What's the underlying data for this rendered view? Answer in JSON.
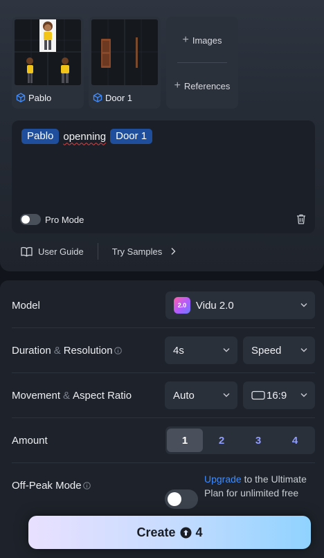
{
  "references": [
    {
      "label": "Pablo"
    },
    {
      "label": "Door 1"
    }
  ],
  "add_buttons": {
    "images": "Images",
    "references": "References"
  },
  "prompt": {
    "chip1": "Pablo",
    "word": "openning",
    "chip2": "Door 1"
  },
  "pro_mode": {
    "label": "Pro Mode",
    "enabled": false
  },
  "links": {
    "user_guide": "User Guide",
    "try_samples": "Try Samples"
  },
  "settings": {
    "model": {
      "label": "Model",
      "value": "Vidu 2.0",
      "logo_text": "2.0"
    },
    "duration_resolution": {
      "label_a": "Duration",
      "amp": "&",
      "label_b": "Resolution",
      "duration": "4s",
      "resolution": "Speed"
    },
    "movement_aspect": {
      "label_a": "Movement",
      "amp": "&",
      "label_b": "Aspect Ratio",
      "movement": "Auto",
      "aspect": "16:9"
    },
    "amount": {
      "label": "Amount",
      "options": [
        "1",
        "2",
        "3",
        "4"
      ],
      "selected": "1"
    },
    "off_peak": {
      "label": "Off-Peak Mode",
      "enabled": false,
      "upgrade_link": "Upgrade",
      "upgrade_rest": " to the Ultimate Plan for unlimited free"
    }
  },
  "create": {
    "label": "Create",
    "credits": "4"
  },
  "colors": {
    "accent": "#3f8cff",
    "chip": "#1f4f9c",
    "amount_text": "#8f9dff"
  }
}
